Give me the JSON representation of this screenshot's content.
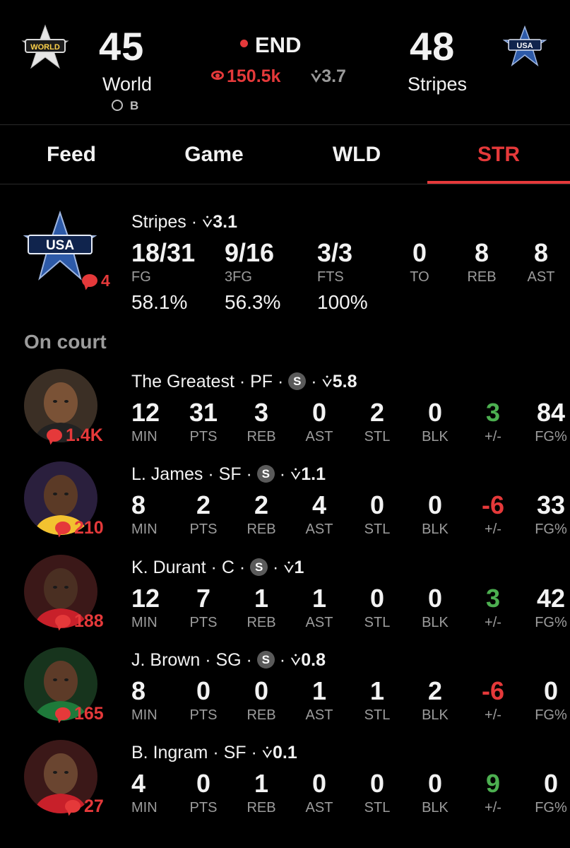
{
  "header": {
    "away": {
      "score": "45",
      "name": "World",
      "sub": "B",
      "logo_text": "WORLD"
    },
    "home": {
      "score": "48",
      "name": "Stripes",
      "logo_text": "USA"
    },
    "status": "END",
    "viewers": "150.5k",
    "rating": "3.7",
    "colors": {
      "accent": "#e5393a",
      "positive": "#4caf50",
      "muted": "#9c9c9c",
      "background": "#000000"
    }
  },
  "tabs": [
    "Feed",
    "Game",
    "WLD",
    "STR"
  ],
  "active_tab": "STR",
  "team_summary": {
    "name": "Stripes",
    "rating": "3.1",
    "comments": "4",
    "logo_text": "USA",
    "stats": [
      {
        "value": "18/31",
        "label": "FG",
        "pct": "58.1%"
      },
      {
        "value": "9/16",
        "label": "3FG",
        "pct": "56.3%"
      },
      {
        "value": "3/3",
        "label": "FTS",
        "pct": "100%"
      },
      {
        "value": "0",
        "label": "TO"
      },
      {
        "value": "8",
        "label": "REB"
      },
      {
        "value": "8",
        "label": "AST"
      }
    ]
  },
  "section_label": "On court",
  "stat_labels": [
    "MIN",
    "PTS",
    "REB",
    "AST",
    "STL",
    "BLK",
    "+/-",
    "FG%"
  ],
  "players": [
    {
      "name": "The Greatest",
      "pos": "PF",
      "starter": true,
      "badge": "S",
      "rating": "5.8",
      "comments": "1.4K",
      "stats": [
        "12",
        "31",
        "3",
        "0",
        "2",
        "0",
        "3",
        "84"
      ]
    },
    {
      "name": "L. James",
      "pos": "SF",
      "starter": true,
      "badge": "S",
      "rating": "1.1",
      "comments": "210",
      "stats": [
        "8",
        "2",
        "2",
        "4",
        "0",
        "0",
        "-6",
        "33"
      ]
    },
    {
      "name": "K. Durant",
      "pos": "C",
      "starter": true,
      "badge": "S",
      "rating": "1",
      "comments": "188",
      "stats": [
        "12",
        "7",
        "1",
        "1",
        "0",
        "0",
        "3",
        "42"
      ]
    },
    {
      "name": "J. Brown",
      "pos": "SG",
      "starter": true,
      "badge": "S",
      "rating": "0.8",
      "comments": "165",
      "stats": [
        "8",
        "0",
        "0",
        "1",
        "1",
        "2",
        "-6",
        "0"
      ]
    },
    {
      "name": "B. Ingram",
      "pos": "SF",
      "starter": false,
      "badge": "",
      "rating": "0.1",
      "comments": "27",
      "stats": [
        "4",
        "0",
        "1",
        "0",
        "0",
        "0",
        "9",
        "0"
      ]
    }
  ],
  "icons": {
    "eye": "eye-icon",
    "rating": "rating-icon",
    "comment": "comment-bubble-icon",
    "ball": "basketball-icon"
  }
}
